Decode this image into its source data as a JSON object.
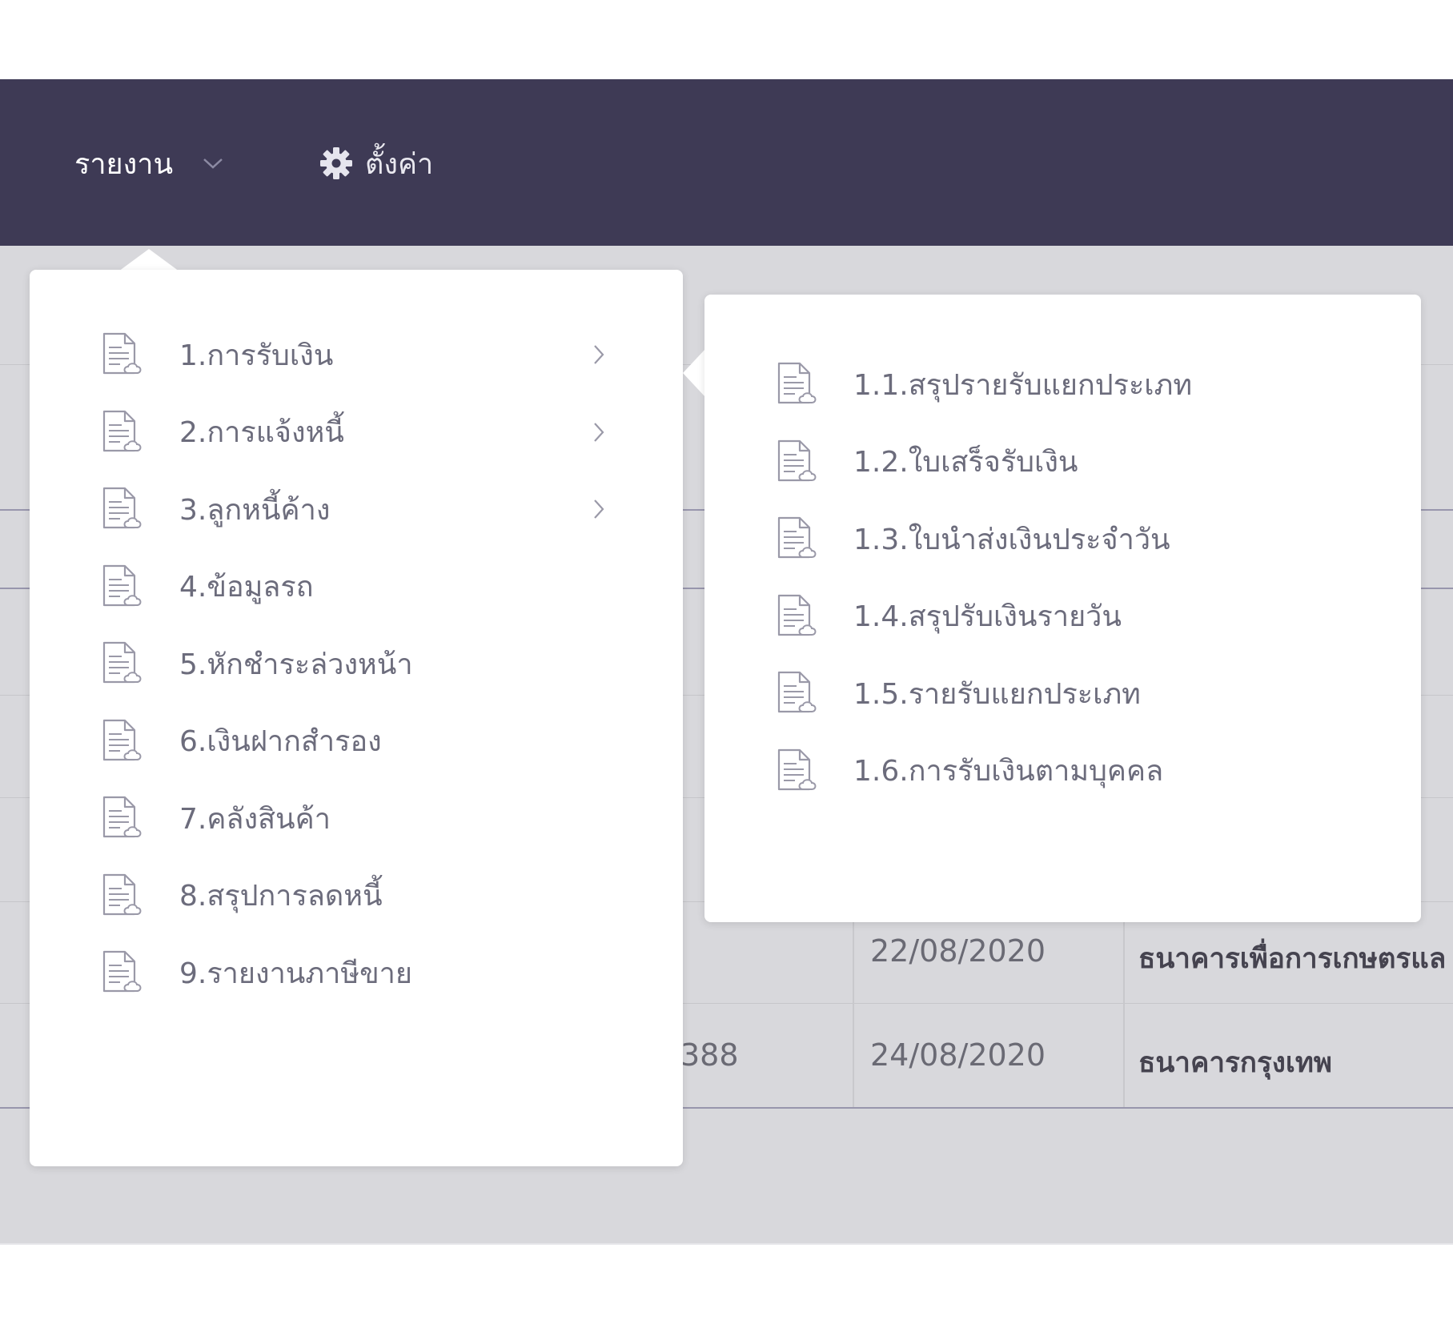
{
  "navbar": {
    "reports_label": "รายงาน",
    "settings_label": "ตั้งค่า",
    "background_color": "#3e3a55"
  },
  "report_menu": {
    "items": [
      {
        "label": "1.การรับเงิน",
        "has_submenu": true,
        "icon": "document-icon"
      },
      {
        "label": "2.การแจ้งหนี้",
        "has_submenu": true,
        "icon": "document-icon"
      },
      {
        "label": "3.ลูกหนี้ค้าง",
        "has_submenu": true,
        "icon": "document-icon"
      },
      {
        "label": "4.ข้อมูลรถ",
        "has_submenu": false,
        "icon": "document-icon"
      },
      {
        "label": "5.หักชำระล่วงหน้า",
        "has_submenu": false,
        "icon": "document-icon"
      },
      {
        "label": "6.เงินฝากสำรอง",
        "has_submenu": false,
        "icon": "document-icon"
      },
      {
        "label": "7.คลังสินค้า",
        "has_submenu": false,
        "icon": "document-icon"
      },
      {
        "label": "8.สรุปการลดหนี้",
        "has_submenu": false,
        "icon": "document-icon"
      },
      {
        "label": "9.รายงานภาษีขาย",
        "has_submenu": false,
        "icon": "document-icon"
      }
    ]
  },
  "submenu": {
    "items": [
      {
        "label": "1.1.สรุปรายรับแยกประเภท",
        "icon": "document-icon"
      },
      {
        "label": "1.2.ใบเสร็จรับเงิน",
        "icon": "document-icon"
      },
      {
        "label": "1.3.ใบนำส่งเงินประจำวัน",
        "icon": "document-icon"
      },
      {
        "label": "1.4.สรุปรับเงินรายวัน",
        "icon": "document-icon"
      },
      {
        "label": "1.5.รายรับแยกประเภท",
        "icon": "document-icon"
      },
      {
        "label": "1.6.การรับเงินตามบุคคล",
        "icon": "document-icon"
      }
    ]
  },
  "table": {
    "rows": [
      {
        "partial": "",
        "date": "22/08/2020",
        "bank": "ธนาคารเพื่อการเกษตรแล"
      },
      {
        "partial": "388",
        "date": "24/08/2020",
        "bank": "ธนาคารกรุงเทพ"
      }
    ]
  }
}
